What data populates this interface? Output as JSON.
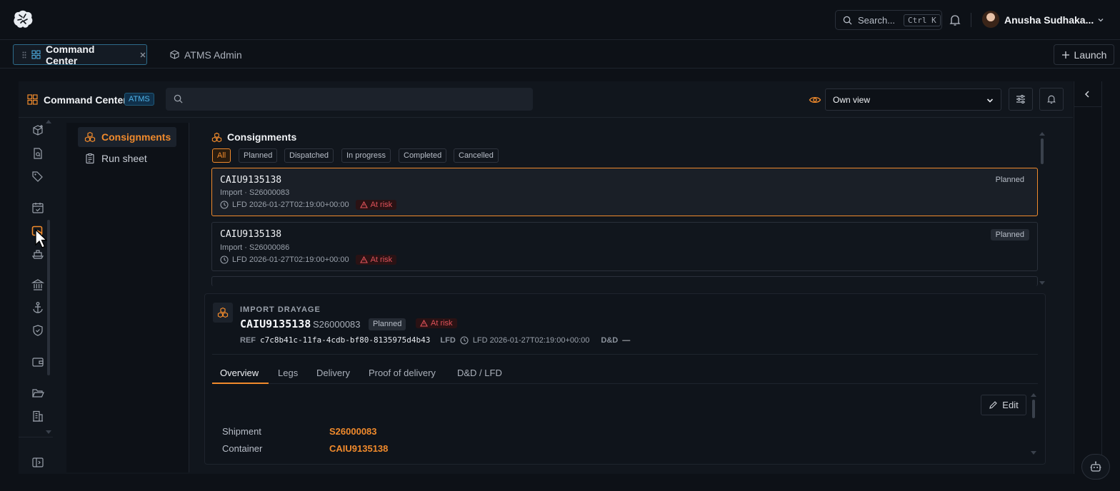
{
  "header": {
    "search_placeholder": "Search...",
    "search_shortcut": "Ctrl K",
    "user_name": "Anusha Sudhaka..."
  },
  "tabs": [
    {
      "label": "Command Center",
      "active": true
    },
    {
      "label": "ATMS Admin",
      "active": false
    }
  ],
  "launch_label": "Launch",
  "app": {
    "title": "Command Center",
    "badge": "ATMS",
    "view_selected": "Own view"
  },
  "subnav": [
    {
      "label": "Consignments",
      "active": true
    },
    {
      "label": "Run sheet",
      "active": false
    }
  ],
  "list": {
    "title": "Consignments",
    "filters": [
      "All",
      "Planned",
      "Dispatched",
      "In progress",
      "Completed",
      "Cancelled"
    ],
    "cards": [
      {
        "id": "CAIU9135138",
        "sub": "Import · S26000083",
        "lfd": "LFD 2026-01-27T02:19:00+00:00",
        "risk": "At risk",
        "status": "Planned"
      },
      {
        "id": "CAIU9135138",
        "sub": "Import · S26000086",
        "lfd": "LFD 2026-01-27T02:19:00+00:00",
        "risk": "At risk",
        "status": "Planned"
      }
    ]
  },
  "detail": {
    "kind": "IMPORT DRAYAGE",
    "id": "CAIU9135138",
    "shipment": "S26000083",
    "status": "Planned",
    "risk": "At risk",
    "ref_label": "REF",
    "ref_value": "c7c8b41c-11fa-4cdb-bf80-8135975d4b43",
    "lfd_label": "LFD",
    "lfd_value": "LFD 2026-01-27T02:19:00+00:00",
    "dd_label": "D&D",
    "dd_value": "—",
    "tabs": [
      "Overview",
      "Legs",
      "Delivery",
      "Proof of delivery",
      "D&D / LFD"
    ],
    "edit_label": "Edit",
    "fields": [
      {
        "key": "Shipment",
        "value": "S26000083"
      },
      {
        "key": "Container",
        "value": "CAIU9135138"
      }
    ]
  },
  "colors": {
    "accent": "#f08a2c",
    "risk": "#e0525a",
    "badge": "#4fb3e8",
    "background": "#0d1117"
  },
  "icons": [
    "brain-logo-icon",
    "search-icon",
    "bell-icon",
    "chevron-down-icon",
    "grid-icon",
    "close-icon",
    "cube-icon",
    "plus-icon",
    "eye-icon",
    "sliders-icon",
    "chevron-left-icon",
    "robot-icon",
    "clock-icon",
    "alert-triangle-icon",
    "pencil-icon"
  ]
}
